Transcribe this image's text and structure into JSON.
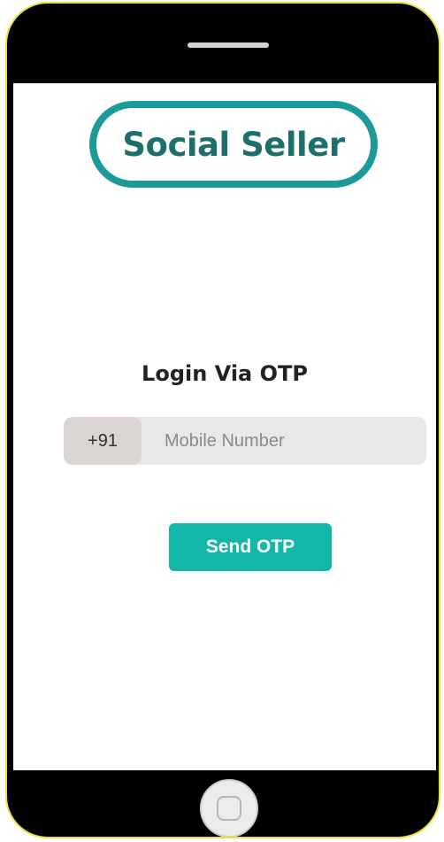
{
  "app": {
    "brand_name": "Social Seller"
  },
  "login": {
    "title": "Login Via OTP",
    "country_code": "+91",
    "mobile_placeholder": "Mobile Number",
    "mobile_value": "",
    "send_button_label": "Send OTP"
  },
  "colors": {
    "brand": "#1d6f6c",
    "logo_border": "#1a9a98",
    "accent": "#13b7a7"
  },
  "icons": {
    "home": "home-button-icon",
    "speaker": "speaker-grille"
  }
}
